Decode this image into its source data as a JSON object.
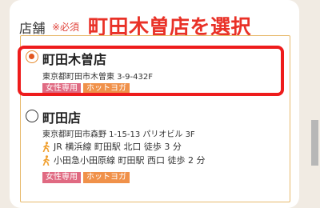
{
  "form": {
    "label": "店舗",
    "required": "※必須"
  },
  "annotation": "町田木曽店を選択",
  "stores": [
    {
      "name": "町田木曽店",
      "address": "東京都町田市木曽東 3-9-432F",
      "selected": true,
      "tags": [
        "女性専用",
        "ホットヨガ"
      ]
    },
    {
      "name": "町田店",
      "address": "東京都町田市森野 1-15-13 パリオビル 3F",
      "selected": false,
      "access": [
        "JR 横浜線 町田駅 北口 徒歩 3 分",
        "小田急小田原線 町田駅 西口 徒歩 2 分"
      ],
      "tags": [
        "女性専用",
        "ホットヨガ"
      ]
    }
  ],
  "colors": {
    "accent": "#e93127",
    "tag_pink": "#e06a82",
    "tag_orange": "#f0914a",
    "radio_selected": "#e2571f"
  }
}
